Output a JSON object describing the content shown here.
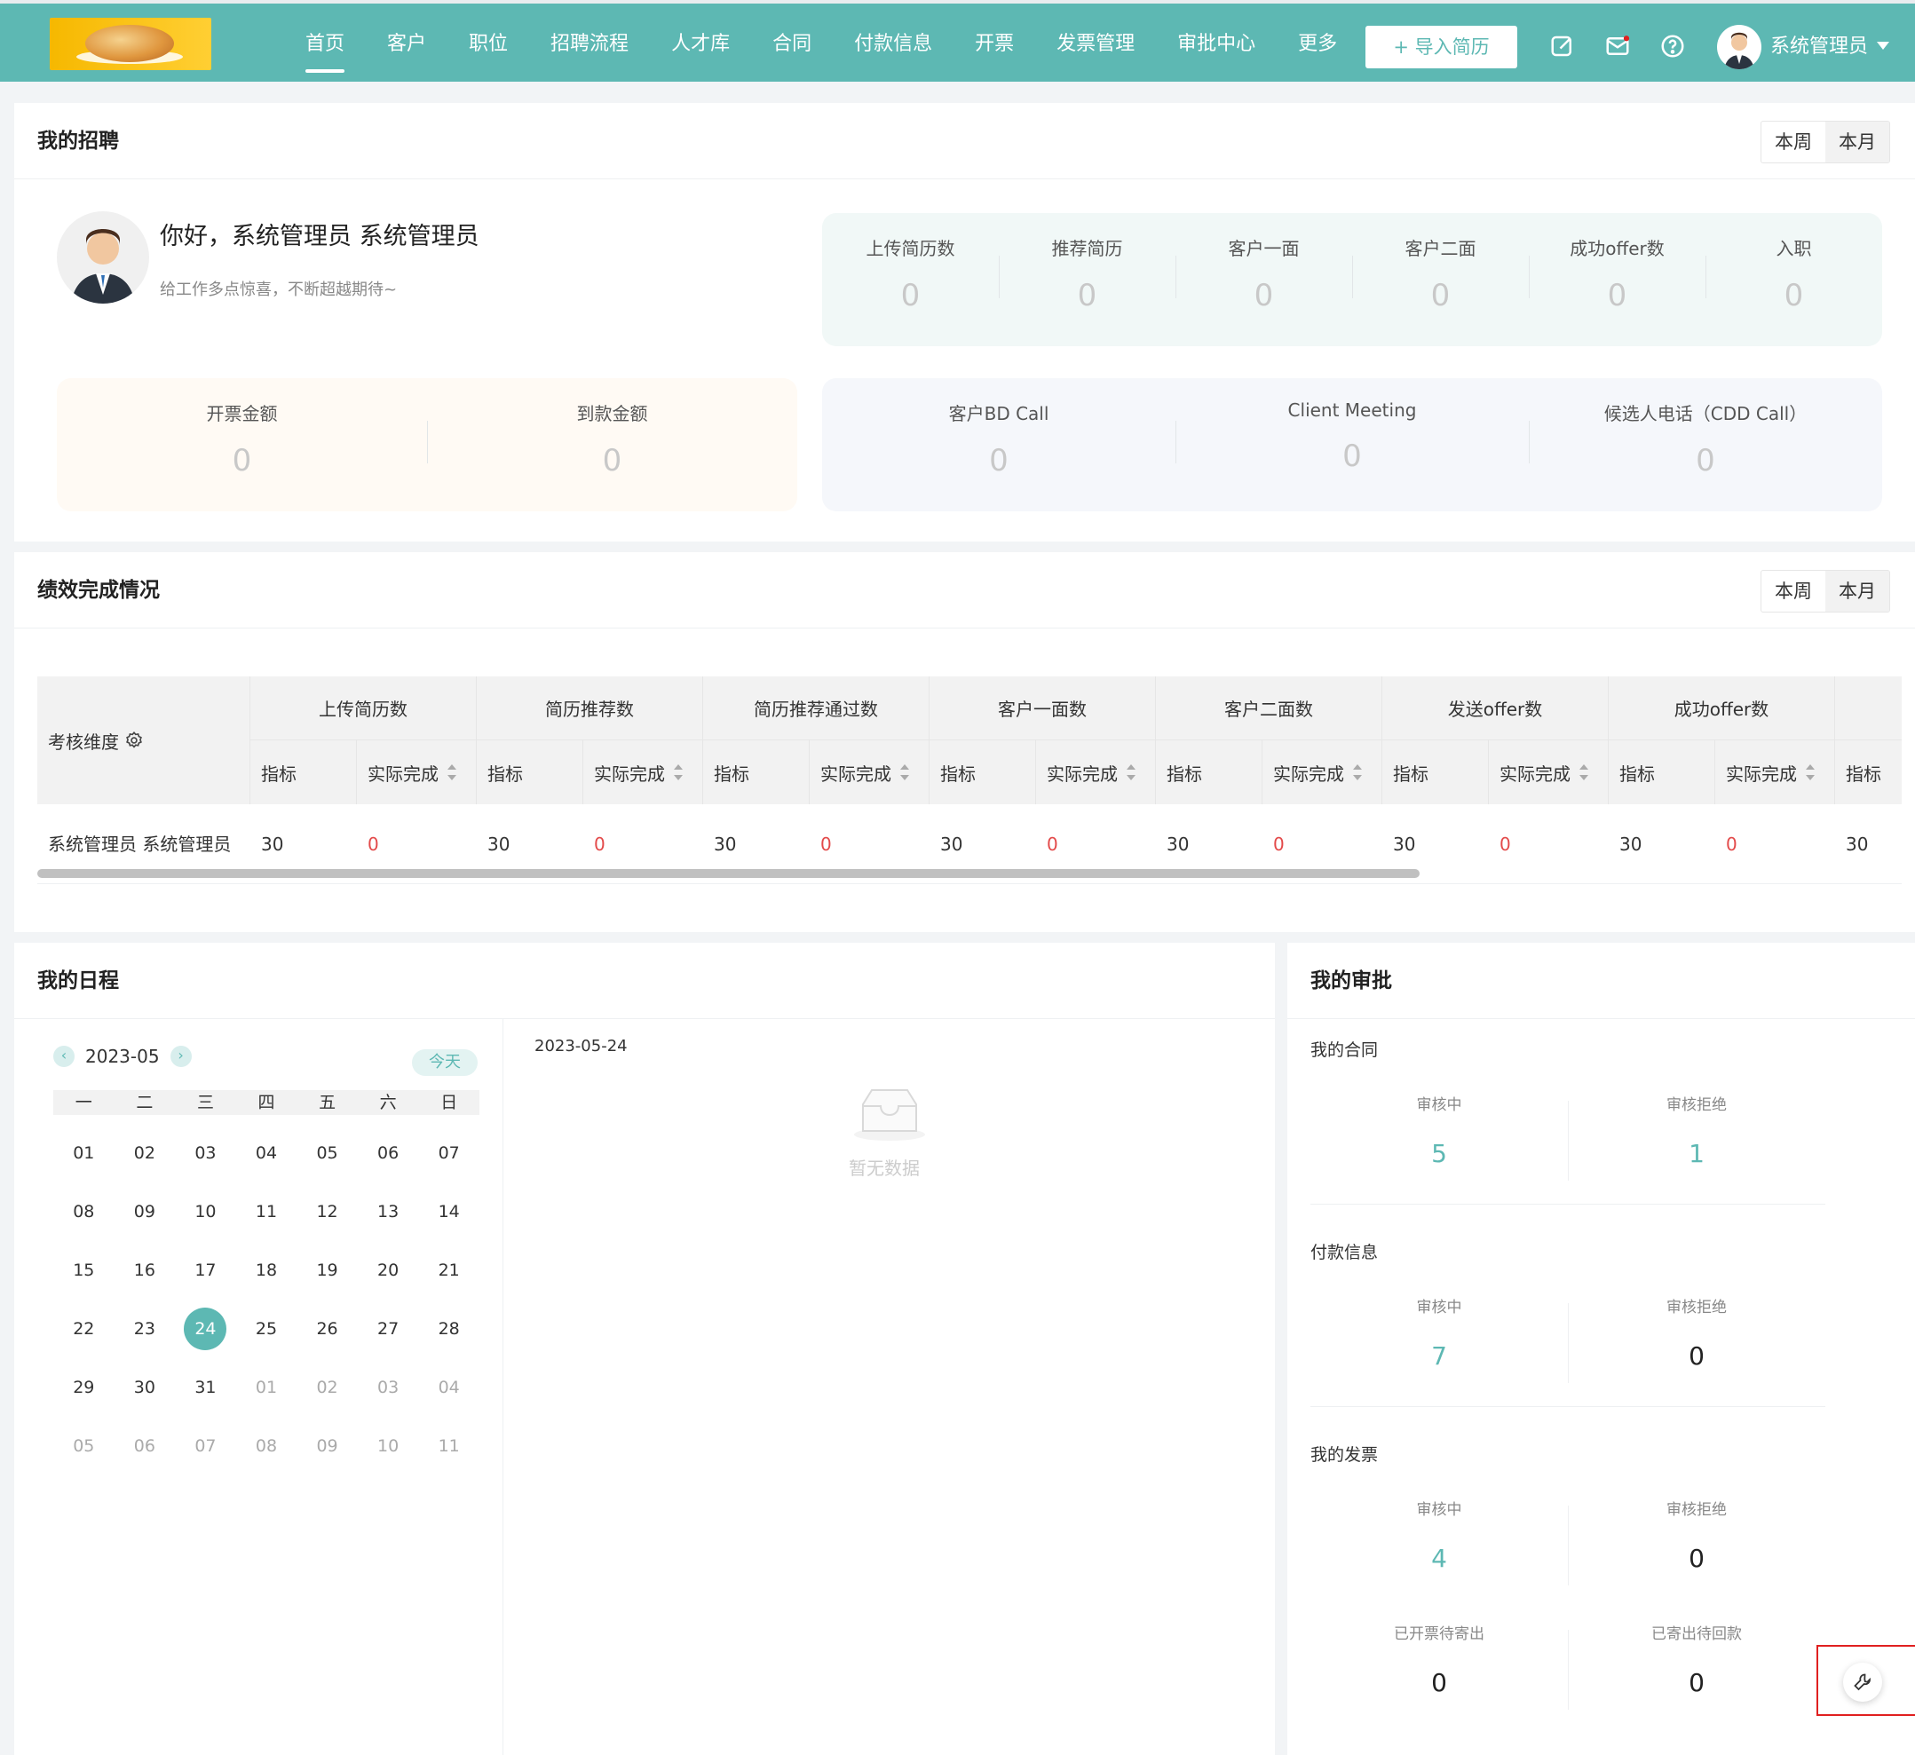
{
  "nav": {
    "items": [
      "首页",
      "客户",
      "职位",
      "招聘流程",
      "人才库",
      "合同",
      "付款信息",
      "开票",
      "发票管理",
      "审批中心",
      "更多"
    ],
    "import_label": "+ 导入简历",
    "user_name": "系统管理员",
    "icons": [
      "edit-icon",
      "mail-icon",
      "help-icon"
    ]
  },
  "recruit": {
    "title": "我的招聘",
    "seg": [
      "本周",
      "本月"
    ],
    "greeting": "你好，系统管理员 系统管理员",
    "subtitle": "给工作多点惊喜，不断超越期待~",
    "stats_top": [
      {
        "label": "上传简历数",
        "value": "0"
      },
      {
        "label": "推荐简历",
        "value": "0"
      },
      {
        "label": "客户一面",
        "value": "0"
      },
      {
        "label": "客户二面",
        "value": "0"
      },
      {
        "label": "成功offer数",
        "value": "0"
      },
      {
        "label": "入职",
        "value": "0"
      }
    ],
    "stats_money": [
      {
        "label": "开票金额",
        "value": "0"
      },
      {
        "label": "到款金额",
        "value": "0"
      }
    ],
    "stats_calls": [
      {
        "label": "客户BD Call",
        "value": "0"
      },
      {
        "label": "Client Meeting",
        "value": "0"
      },
      {
        "label": "候选人电话（CDD Call）",
        "value": "0"
      }
    ]
  },
  "perf": {
    "title": "绩效完成情况",
    "seg": [
      "本周",
      "本月"
    ],
    "dimension_label": "考核维度",
    "groups": [
      "上传简历数",
      "简历推荐数",
      "简历推荐通过数",
      "客户一面数",
      "客户二面数",
      "发送offer数",
      "成功offer数"
    ],
    "sub_target": "指标",
    "sub_actual": "实际完成",
    "row_name": "系统管理员 系统管理员",
    "row_target": "30",
    "row_actual": "0"
  },
  "schedule": {
    "title": "我的日程",
    "month": "2023-05",
    "today": "今天",
    "weekdays": [
      "一",
      "二",
      "三",
      "四",
      "五",
      "六",
      "日"
    ],
    "days": [
      "01",
      "02",
      "03",
      "04",
      "05",
      "06",
      "07",
      "08",
      "09",
      "10",
      "11",
      "12",
      "13",
      "14",
      "15",
      "16",
      "17",
      "18",
      "19",
      "20",
      "21",
      "22",
      "23",
      "24",
      "25",
      "26",
      "27",
      "28",
      "29",
      "30",
      "31",
      "01",
      "02",
      "03",
      "04",
      "05",
      "06",
      "07",
      "08",
      "09",
      "10",
      "11"
    ],
    "selected_index": 23,
    "current_month_count": 31,
    "selected_date": "2023-05-24",
    "empty": "暂无数据"
  },
  "approval": {
    "title": "我的审批",
    "sections": [
      {
        "title": "我的合同",
        "items": [
          {
            "label": "审核中",
            "value": "5",
            "accent": true
          },
          {
            "label": "审核拒绝",
            "value": "1",
            "accent": true
          }
        ]
      },
      {
        "title": "付款信息",
        "items": [
          {
            "label": "审核中",
            "value": "7",
            "accent": true
          },
          {
            "label": "审核拒绝",
            "value": "0",
            "accent": false
          }
        ]
      },
      {
        "title": "我的发票",
        "items": [
          {
            "label": "审核中",
            "value": "4",
            "accent": true
          },
          {
            "label": "审核拒绝",
            "value": "0",
            "accent": false
          }
        ]
      }
    ],
    "extra": [
      {
        "label": "已开票待寄出",
        "value": "0"
      },
      {
        "label": "已寄出待回款",
        "value": "0"
      }
    ]
  },
  "colors": {
    "accent": "#5db8b3",
    "red": "#e34a4a"
  }
}
